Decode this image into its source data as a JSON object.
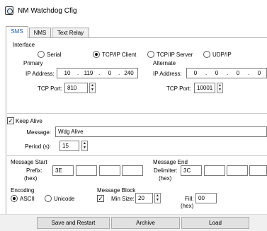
{
  "window": {
    "title": "NM Watchdog Cfig"
  },
  "tabs": [
    {
      "label": "SMS",
      "active": true
    },
    {
      "label": "NMS",
      "active": false
    },
    {
      "label": "Text Relay",
      "active": false
    }
  ],
  "interface": {
    "heading": "Interface",
    "options": [
      {
        "label": "Serial",
        "selected": false
      },
      {
        "label": "TCP/IP Client",
        "selected": true
      },
      {
        "label": "TCP/IP Server",
        "selected": false
      },
      {
        "label": "UDP/IP",
        "selected": false
      }
    ],
    "primary": {
      "heading": "Primary",
      "ip_label": "IP Address:",
      "ip": [
        "10",
        "119",
        "0",
        "240"
      ],
      "port_label": "TCP Port:",
      "port": "810"
    },
    "alternate": {
      "heading": "Alternate",
      "ip_label": "IP Address:",
      "ip": [
        "0",
        "0",
        "0",
        "0"
      ],
      "port_label": "TCP Port:",
      "port": "10001"
    }
  },
  "keep_alive": {
    "label": "Keep Alive",
    "checked": true,
    "message_label": "Message:",
    "message": "Wdg Alive",
    "period_label": "Period (s):",
    "period": "15"
  },
  "message_start": {
    "heading": "Message Start",
    "prefix_label": "Prefix:",
    "hex_note": "(hex)",
    "bytes": [
      "3E",
      "",
      "",
      ""
    ]
  },
  "message_end": {
    "heading": "Message End",
    "delimiter_label": "Delimiter:",
    "hex_note": "(hex)",
    "bytes": [
      "3C",
      "",
      "",
      "",
      ""
    ]
  },
  "encoding": {
    "heading": "Encoding",
    "options": [
      {
        "label": "ASCII",
        "selected": true
      },
      {
        "label": "Unicode",
        "selected": false
      }
    ]
  },
  "message_block": {
    "heading": "Message Block",
    "min_size_label": "Min Size:",
    "min_size_checked": true,
    "min_size": "20",
    "fill_label": "Fill:",
    "fill_hex_note": "(hex)",
    "fill": "00"
  },
  "footer": {
    "save_restart_label": "Save and Restart",
    "archive_label": "Archive",
    "load_label": "Load"
  },
  "glyphs": {
    "check": "✓",
    "spin_up": "▲",
    "spin_down": "▼"
  }
}
